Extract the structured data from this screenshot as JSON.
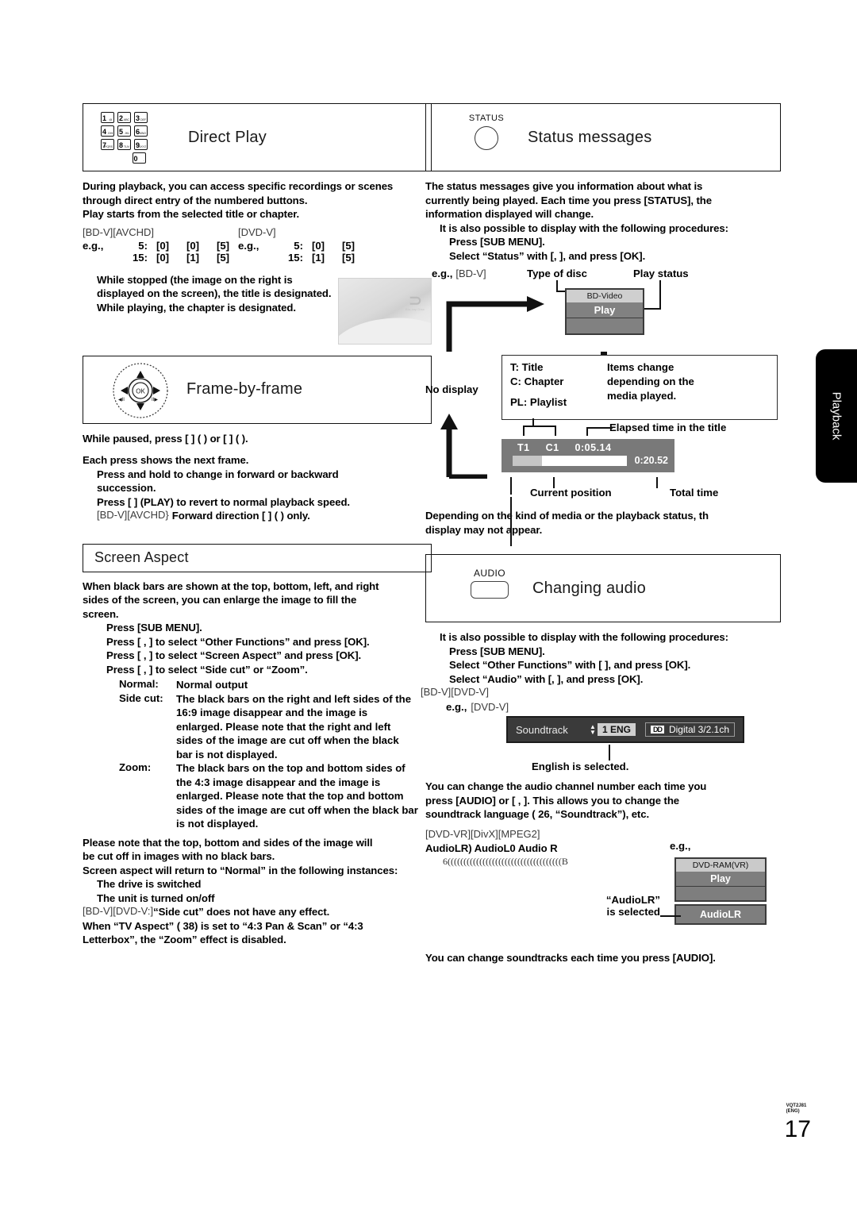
{
  "page": {
    "number": "17",
    "doc_code": "VQT2J81",
    "doc_lang": "(ENG)",
    "side_tab": "Playback"
  },
  "direct_play": {
    "title": "Direct Play",
    "icon": "numeric-keypad-icon",
    "keys": [
      {
        "n": "1",
        "sub": "@."
      },
      {
        "n": "2",
        "sub": "ABC"
      },
      {
        "n": "3",
        "sub": "DEF"
      },
      {
        "n": "4",
        "sub": "GHI"
      },
      {
        "n": "5",
        "sub": "JKL"
      },
      {
        "n": "6",
        "sub": "MNO"
      },
      {
        "n": "7",
        "sub": "PQRS"
      },
      {
        "n": "8",
        "sub": "TUV"
      },
      {
        "n": "9",
        "sub": "WXYZ"
      },
      {
        "n": "0",
        "sub": "-"
      }
    ],
    "p1": "During playback, you can access specific recordings or scenes",
    "p2": "through direct entry of the numbered buttons.",
    "p3": "Play starts from the selected title or chapter.",
    "tag_left": "[BD-V][AVCHD]",
    "tag_right": "[DVD-V]",
    "eg_left": [
      {
        "eg": "e.g.,",
        "num": "5:",
        "k1": "[0]",
        "k2": "[0]",
        "k3": "[5]"
      },
      {
        "eg": "",
        "num": "15:",
        "k1": "[0]",
        "k2": "[1]",
        "k3": "[5]"
      }
    ],
    "eg_right": [
      {
        "eg": "e.g.,",
        "num": "5:",
        "k1": "[0]",
        "k2": "[5]",
        "k3": ""
      },
      {
        "eg": "",
        "num": "15:",
        "k1": "[1]",
        "k2": "[5]",
        "k3": ""
      }
    ],
    "note": "While stopped (the image on the right is displayed on the screen), the title is designated. While playing, the chapter is designated.",
    "thumb_logo": "Blu-ray Disc"
  },
  "frame_by_frame": {
    "title": "Frame-by-frame",
    "icon": "dpad-ok-icon",
    "ok_label": "OK",
    "l1": "While paused, press [ ] (        ) or [   ] (        ).",
    "l2": "Each press shows the next frame.",
    "l3": "Press and hold to change in forward or backward",
    "l4": "succession.",
    "l5": "Press [   ] (PLAY) to revert to normal playback speed.",
    "l6_tag": "[BD-V][AVCHD}",
    "l6": "Forward direction [ ] (        ) only."
  },
  "screen_aspect": {
    "title": "Screen Aspect",
    "p1": "When black bars are shown at the top, bottom, left, and right",
    "p2": "sides of the screen, you can enlarge the image to fill the",
    "p3": "screen.",
    "s1": "Press [SUB MENU].",
    "s2": "Press [   ,     ] to select “Other Functions” and press [OK].",
    "s3": "Press [   ,     ] to select “Screen Aspect” and press [OK].",
    "s4": "Press [   ,     ] to select “Side cut” or “Zoom”.",
    "defs": [
      {
        "term": "Normal:",
        "desc": "Normal output"
      },
      {
        "term": "Side cut:",
        "desc": "The black bars on the right and left sides of the 16:9 image disappear and the image is enlarged. Please note that the right and left sides of the image are cut off when the black bar is not displayed."
      },
      {
        "term": "Zoom:",
        "desc": "The black bars on the top and bottom sides of the 4:3 image disappear and the image is enlarged. Please note that the top and bottom sides of the image are cut off when the black bar is not displayed."
      }
    ],
    "n1": "Please note that the top, bottom and sides of the image will",
    "n2": "be cut off in images with no black bars.",
    "n3": "Screen aspect will return to “Normal” in the following instances:",
    "n4": "The drive is switched",
    "n5": "The unit is turned on/off",
    "n6_tag": "[BD-V][DVD-V:]",
    "n6": "“Side cut” does not have any effect.",
    "n7": "When “TV Aspect” (  38) is set to “4:3 Pan & Scan” or “4:3",
    "n8": "Letterbox”, the “Zoom” effect is disabled."
  },
  "status_messages": {
    "title": "Status messages",
    "icon": "status-round-button-icon",
    "icon_label": "STATUS",
    "p1": "The status messages give you information about what is",
    "p2": "currently being played. Each time you press [STATUS], the",
    "p3": "information displayed will change.",
    "s0": "It is also possible to display with the following procedures:",
    "s1": "Press [SUB MENU].",
    "s2": "Select “Status” with [,     ], and press [OK].",
    "eg": "e.g.,",
    "eg_tag": "[BD-V]",
    "lbl_type": "Type of disc",
    "lbl_play": "Play status",
    "osd_disc": "BD-Video",
    "osd_play": "Play",
    "no_display": "No display",
    "items_left": [
      "T: Title",
      "C: Chapter",
      "PL: Playlist"
    ],
    "items_right": [
      "Items change",
      "depending on the",
      "media played."
    ],
    "lbl_elapsed": "Elapsed time in the title",
    "bar_title": "T1",
    "bar_chapter": "C1",
    "bar_elapsed": "0:05.14",
    "bar_total": "0:20.52",
    "lbl_current": "Current position",
    "lbl_total": "Total time",
    "foot1": "Depending on the kind of media or the playback status, th",
    "foot2": "display may not appear."
  },
  "changing_audio": {
    "title": "Changing audio",
    "icon": "audio-button-icon",
    "icon_label": "AUDIO",
    "s0": "It is also possible to display with the following procedures:",
    "s1": "Press [SUB MENU].",
    "s2": "Select “Other Functions” with [     ], and press [OK].",
    "s3": "Select “Audio” with [,     ], and press [OK].",
    "tag1": "[BD-V][DVD-V]",
    "eg": "e.g.,",
    "eg_tag": "[DVD-V]",
    "osd_soundtrack": "Soundtrack",
    "osd_chip": "1 ENG",
    "osd_dd_logo": "DD",
    "osd_dd_text": "Digital  3/2.1ch",
    "english_note": "English is selected.",
    "p1": "You can change the audio channel number each time you",
    "p2": "press [AUDIO] or [  ,     ]. This allows you to change the",
    "p3": "soundtrack language (  26, “Soundtrack”), etc.",
    "tag2": "[DVD-VR][DivX][MPEG2]",
    "audio_opts": "AudioLR)  AudioL0  Audio R",
    "audio_arrows": "6((((((((((((((((((((((((((((((((((((B",
    "eg2": "e.g.,",
    "osd2_disc": "DVD-RAM(VR)",
    "osd2_play": "Play",
    "osd2_audio": "AudioLR",
    "sel1": "“AudioLR”",
    "sel2": "is selected",
    "foot": "You can change soundtracks each time you press [AUDIO]."
  }
}
